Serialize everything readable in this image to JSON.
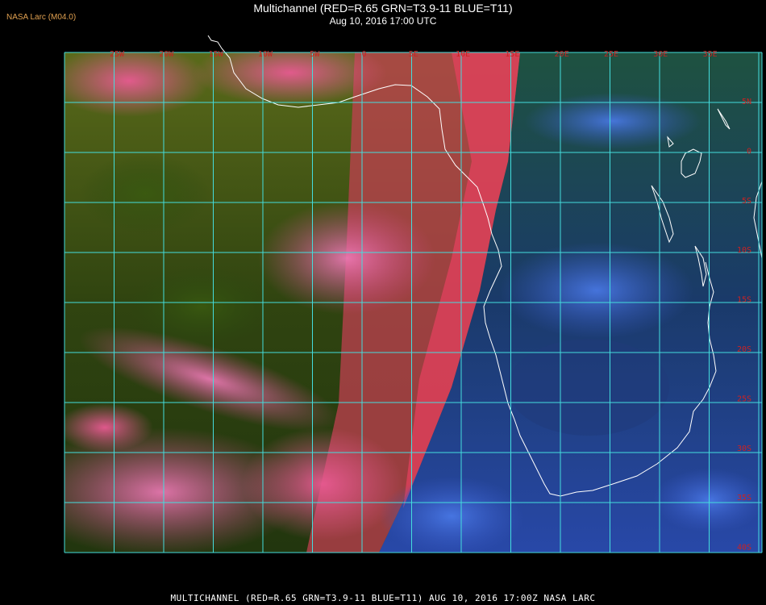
{
  "header": {
    "producer": "NASA Larc (M04.0)",
    "title_line1": "Multichannel (RED=R.65 GRN=T3.9-11 BLUE=T11)",
    "title_line2": "Aug 10, 2016 17:00 UTC"
  },
  "footer": {
    "caption": "MULTICHANNEL (RED=R.65 GRN=T3.9-11 BLUE=T11) AUG 10, 2016 17:00Z  NASA LARC"
  },
  "map": {
    "grid_color": "#44dddd",
    "label_color": "#cc2222",
    "coast_color": "#ffffff",
    "longitude_labels": [
      "25W",
      "20W",
      "15W",
      "10W",
      "5W",
      "0",
      "5E",
      "10E",
      "15E",
      "20E",
      "25E",
      "30E",
      "35E"
    ],
    "latitude_labels": [
      "5N",
      "0",
      "5S",
      "10S",
      "15S",
      "20S",
      "25S",
      "30S",
      "35S",
      "40S"
    ]
  }
}
